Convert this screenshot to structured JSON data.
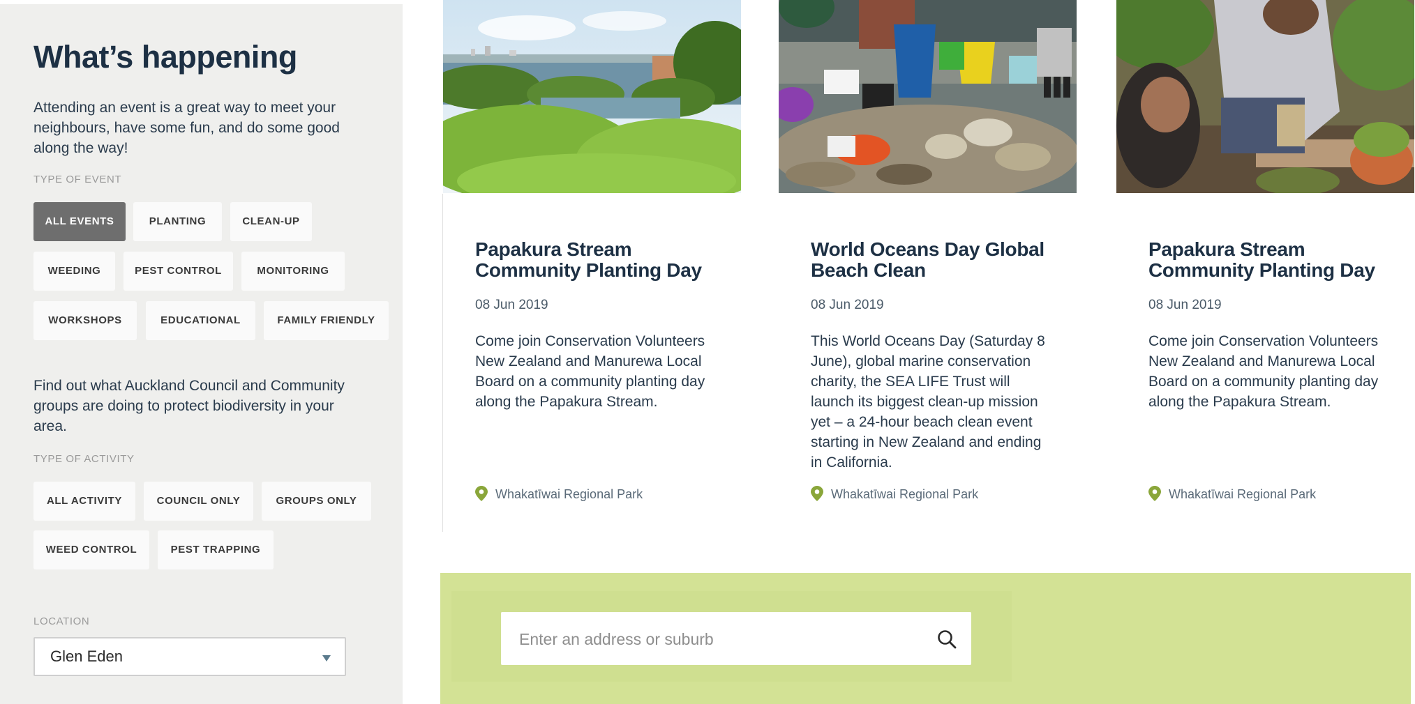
{
  "sidebar": {
    "title": "What’s happening",
    "intro": "Attending an event is a great way to meet your neighbours, have some fun, and do some good along the way!",
    "event_type_label": "TYPE OF EVENT",
    "event_types": [
      "ALL EVENTS",
      "PLANTING",
      "CLEAN-UP",
      "WEEDING",
      "PEST CONTROL",
      "MONITORING",
      "WORKSHOPS",
      "EDUCATIONAL",
      "FAMILY FRIENDLY"
    ],
    "active_event_type": "ALL EVENTS",
    "activity_intro": "Find out what Auckland Council and Community groups are doing to protect biodiversity in your area.",
    "activity_type_label": "TYPE OF ACTIVITY",
    "activity_types": [
      "ALL ACTIVITY",
      "COUNCIL ONLY",
      "GROUPS ONLY",
      "WEED CONTROL",
      "PEST TRAPPING"
    ],
    "location_label": "LOCATION",
    "location_value": "Glen Eden"
  },
  "cards": [
    {
      "title": "Papakura Stream Community Planting Day",
      "date": "08 Jun 2019",
      "description": "Come join Conservation Volunteers New Zealand and Manurewa Local Board on a community planting day along the Papakura Stream.",
      "location": "Whakatīwai Regional Park",
      "image": "river-landscape"
    },
    {
      "title": "World Oceans Day Global Beach Clean",
      "date": "08 Jun 2019",
      "description": "This World Oceans Day (Saturday 8 June), global marine conservation charity, the SEA LIFE Trust will launch its biggest clean-up mission yet – a 24-hour beach clean event starting in New Zealand and ending in California.",
      "location": "Whakatīwai Regional Park",
      "image": "beach-rubbish-buckets"
    },
    {
      "title": "Papakura Stream Community Planting Day",
      "date": "08 Jun 2019",
      "description": "Come join Conservation Volunteers New Zealand and Manurewa Local Board on a community planting day along the Papakura Stream.",
      "location": "Whakatīwai Regional Park",
      "image": "garden-trap-family"
    }
  ],
  "search": {
    "placeholder": "Enter an address or suburb",
    "icon": "search-icon"
  },
  "colors": {
    "sidebar_bg": "#efefed",
    "active_chip": "#6e6e6e",
    "heading": "#1d3044",
    "search_band": "#d3e295",
    "pin": "#8aa63a"
  }
}
